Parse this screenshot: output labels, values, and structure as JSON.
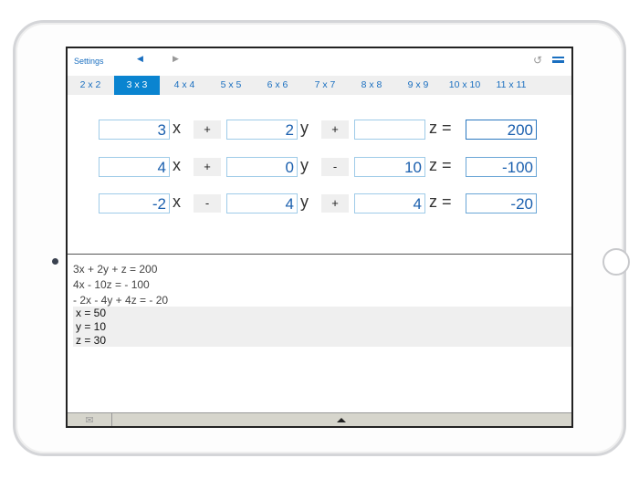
{
  "header": {
    "settings": "Settings",
    "prev": "◀",
    "next": "▶",
    "undo": "↺"
  },
  "tabs": [
    "2 x 2",
    "3 x 3",
    "4 x 4",
    "5 x 5",
    "6 x 6",
    "7 x 7",
    "8 x 8",
    "9 x 9",
    "10 x 10",
    "11 x 11"
  ],
  "active_tab": "3 x 3",
  "rows": [
    {
      "a": "3",
      "op1": "+",
      "b": "2",
      "op2": "+",
      "c": "",
      "r": "200"
    },
    {
      "a": "4",
      "op1": "+",
      "b": "0",
      "op2": "-",
      "c": "10",
      "r": "-100"
    },
    {
      "a": "-2",
      "op1": "-",
      "b": "4",
      "op2": "+",
      "c": "4",
      "r": "-20"
    }
  ],
  "vars": {
    "x": "x",
    "y": "y",
    "z": "z ="
  },
  "output": {
    "equations": [
      "3x + 2y + z = 200",
      "4x - 10z = - 100",
      "- 2x - 4y + 4z = - 20"
    ],
    "solution": [
      "x = 50",
      "y = 10",
      "z = 30"
    ]
  },
  "icons": {
    "mail": "envelope-icon",
    "expand": "triangle-up-icon",
    "menu": "hamburger-icon"
  }
}
